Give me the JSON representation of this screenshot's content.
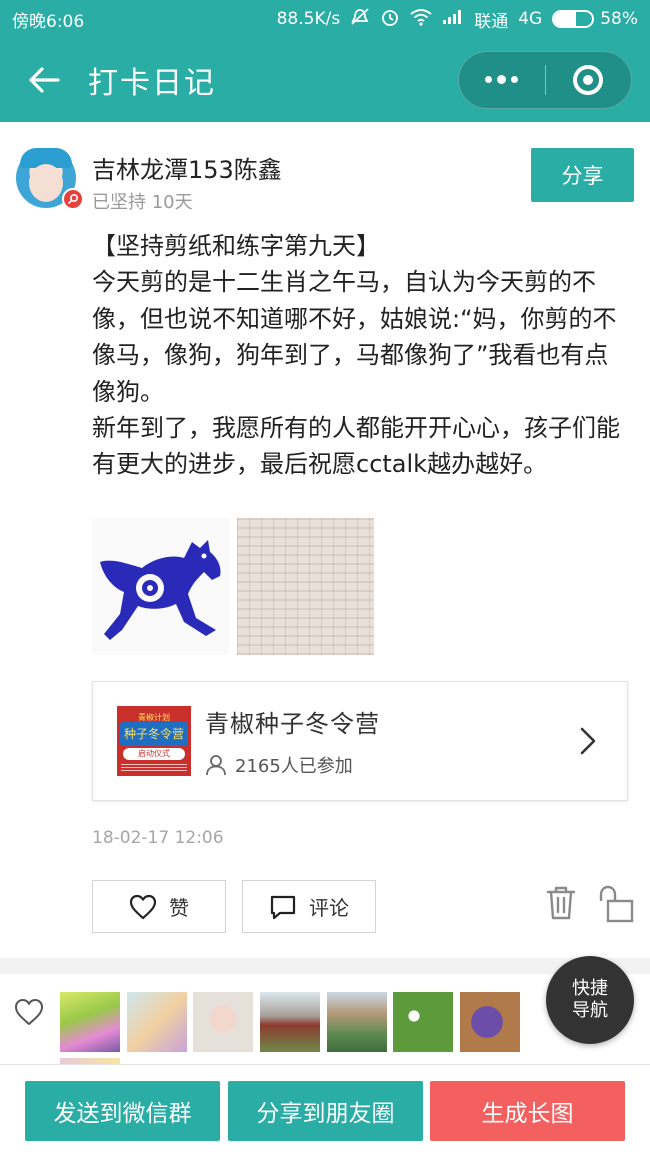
{
  "status_bar": {
    "time": "傍晚6:06",
    "network_speed": "88.5K/s",
    "carrier": "联通",
    "network_type": "4G",
    "battery": "58%",
    "battery_level": 0.58
  },
  "app_bar": {
    "title": "打卡日记"
  },
  "post": {
    "username": "吉林龙潭153陈鑫",
    "streak": "已坚持 10天",
    "share_label": "分享",
    "paragraphs": [
      "【坚持剪纸和练字第九天】",
      "今天剪的是十二生肖之午马，自认为今天剪的不像，但也说不知道哪不好，姑娘说:“妈，你剪的不像马，像狗，狗年到了，马都像狗了”我看也有点像狗。",
      "新年到了，我愿所有的人都能开开心心，孩子们能有更大的进步，最后祝愿cctalk越办越好。"
    ],
    "timestamp": "18-02-17 12:06"
  },
  "camp": {
    "name": "青椒种子冬令营",
    "participants": "2165人已参加",
    "poster": {
      "top": "青椒计划",
      "main": "种子冬令营",
      "sub": "启动仪式"
    }
  },
  "actions": {
    "like_label": "赞",
    "comment_label": "评论"
  },
  "floating_button": {
    "line1": "快捷",
    "line2": "导航"
  },
  "bottom_bar": {
    "send_wechat_group": "发送到微信群",
    "share_moments": "分享到朋友圈",
    "generate_long_image": "生成长图"
  },
  "colors": {
    "primary": "#29ada4",
    "danger": "#f45f60",
    "badge": "#e9403c"
  }
}
